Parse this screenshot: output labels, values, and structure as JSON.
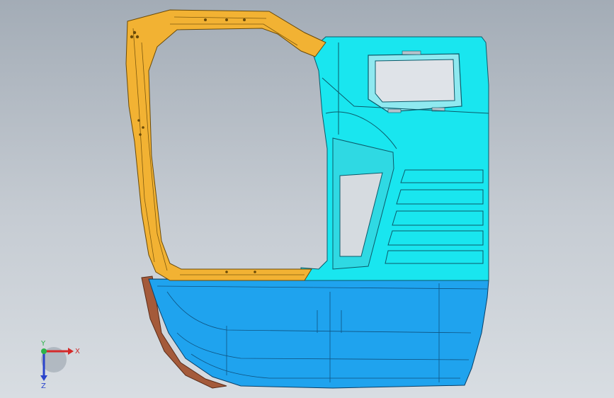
{
  "viewport": {
    "background_top": "#a3acb6",
    "background_bottom": "#d8dde2"
  },
  "model": {
    "parts": [
      {
        "name": "door-frame-reinforcement",
        "color": "#f2b233"
      },
      {
        "name": "door-inner-panel",
        "color": "#19e6ef"
      },
      {
        "name": "door-lower-skin",
        "color": "#1fa3ee"
      },
      {
        "name": "door-edge-seal",
        "color": "#a45a3a"
      }
    ]
  },
  "triad": {
    "x_label": "X",
    "y_label": "Y",
    "z_label": "Z",
    "x_color": "#d42a2a",
    "y_color": "#2db34a",
    "z_color": "#2a44cc"
  }
}
